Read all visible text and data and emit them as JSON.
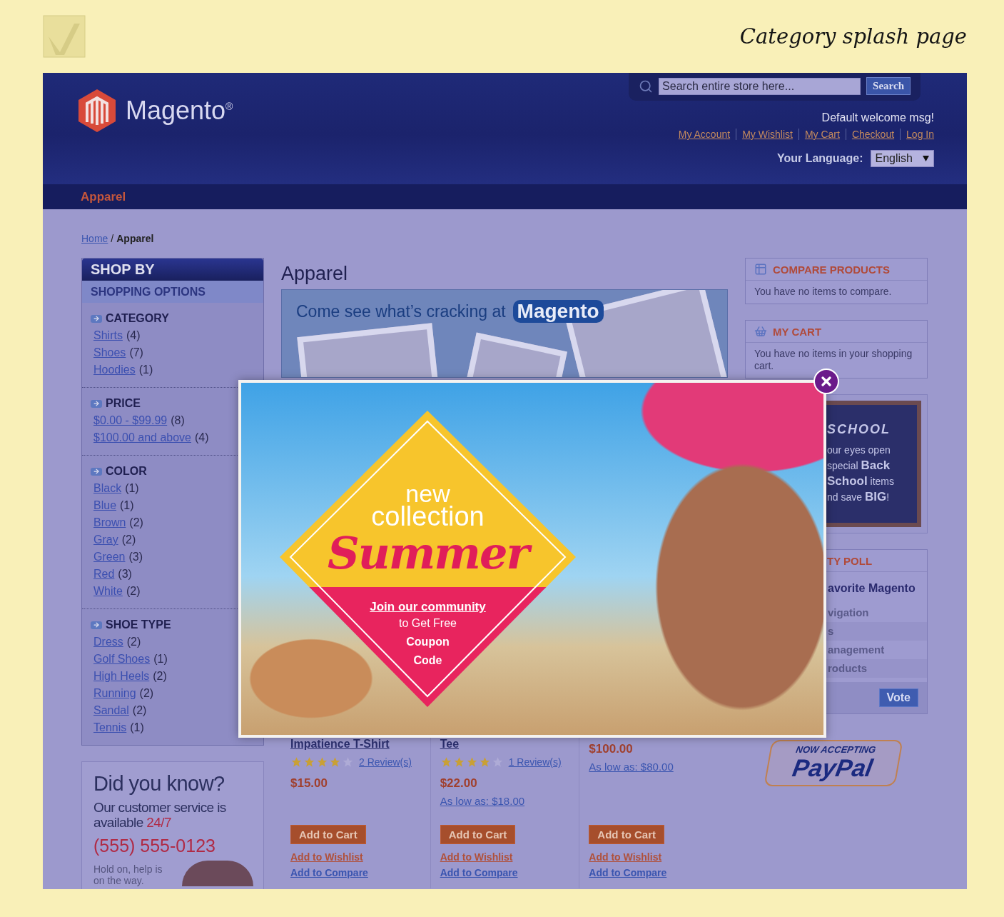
{
  "page_title": "Category splash page",
  "header": {
    "brand": "Magento$^{®}$",
    "search": {
      "placeholder": "Search entire store here...",
      "button": "Search"
    },
    "welcome": "Default welcome msg!",
    "links": [
      "My Account",
      "My Wishlist",
      "My Cart",
      "Checkout",
      "Log In"
    ],
    "language": {
      "label": "Your Language:",
      "value": "English"
    }
  },
  "nav": [
    {
      "label": "Apparel",
      "selected": true
    }
  ],
  "breadcrumbs": {
    "home": "Home",
    "separator": "/",
    "current": "Apparel"
  },
  "sidebar": {
    "title": "SHOP BY",
    "subtitle": "SHOPPING OPTIONS",
    "groups": [
      {
        "title": "CATEGORY",
        "items": [
          {
            "label": "Shirts",
            "count": "(4)"
          },
          {
            "label": "Shoes",
            "count": "(7)"
          },
          {
            "label": "Hoodies",
            "count": "(1)"
          }
        ]
      },
      {
        "title": "PRICE",
        "items": [
          {
            "label": "$0.00 - $99.99",
            "count": "(8)"
          },
          {
            "label": "$100.00 and above",
            "count": "(4)"
          }
        ]
      },
      {
        "title": "COLOR",
        "items": [
          {
            "label": "Black",
            "count": "(1)"
          },
          {
            "label": "Blue",
            "count": "(1)"
          },
          {
            "label": "Brown",
            "count": "(2)"
          },
          {
            "label": "Gray",
            "count": "(2)"
          },
          {
            "label": "Green",
            "count": "(3)"
          },
          {
            "label": "Red",
            "count": "(3)"
          },
          {
            "label": "White",
            "count": "(2)"
          }
        ]
      },
      {
        "title": "SHOE TYPE",
        "items": [
          {
            "label": "Dress",
            "count": "(2)"
          },
          {
            "label": "Golf Shoes",
            "count": "(1)"
          },
          {
            "label": "High Heels",
            "count": "(2)"
          },
          {
            "label": "Running",
            "count": "(2)"
          },
          {
            "label": "Sandal",
            "count": "(2)"
          },
          {
            "label": "Tennis",
            "count": "(1)"
          }
        ]
      }
    ],
    "promo": {
      "title": "Did you know?",
      "text": "Our customer service is available",
      "highlight": "24/7",
      "phone": "(555) 555-0123",
      "note": "Hold on, help is on the way."
    }
  },
  "main": {
    "title": "Apparel",
    "banner": {
      "text": "Come see what’s cracking at",
      "brand": "Magento"
    },
    "products": [
      {
        "name": "Impatience T-Shirt",
        "stars": 4,
        "reviews": "2 Review(s)",
        "price": "$15.00",
        "add_to_cart": "Add to Cart",
        "wishlist": "Add to Wishlist",
        "compare": "Add to Compare"
      },
      {
        "name": "Tee",
        "stars": 4,
        "reviews": "1 Review(s)",
        "price": "$22.00",
        "as_low_as": "As low as: $18.00",
        "add_to_cart": "Add to Cart",
        "wishlist": "Add to Wishlist",
        "compare": "Add to Compare"
      },
      {
        "price": "$100.00",
        "as_low_as": "As low as: $80.00",
        "add_to_cart": "Add to Cart",
        "wishlist": "Add to Wishlist",
        "compare": "Add to Compare"
      }
    ]
  },
  "right": {
    "compare": {
      "title": "COMPARE PRODUCTS",
      "text": "You have no items to compare."
    },
    "cart": {
      "title": "MY CART",
      "text": "You have no items in your shopping cart."
    },
    "school_banner": {
      "title": "SCHOOL",
      "lines": [
        "our eyes open",
        "special **Back**",
        "**School** items",
        "nd save **BIG**!"
      ]
    },
    "poll": {
      "title": "TY POLL",
      "question": "avorite Magento",
      "options": [
        "vigation",
        "s",
        "anagement",
        "roducts"
      ],
      "button": "Vote"
    },
    "paypal": {
      "tagline": "NOW ACCEPTING",
      "logo": "PayPal"
    }
  },
  "popup": {
    "line1": "new",
    "line2": "collection",
    "headline": "Summer",
    "link": "Join our community",
    "lines": [
      "to Get Free",
      "Coupon",
      "Code"
    ]
  }
}
